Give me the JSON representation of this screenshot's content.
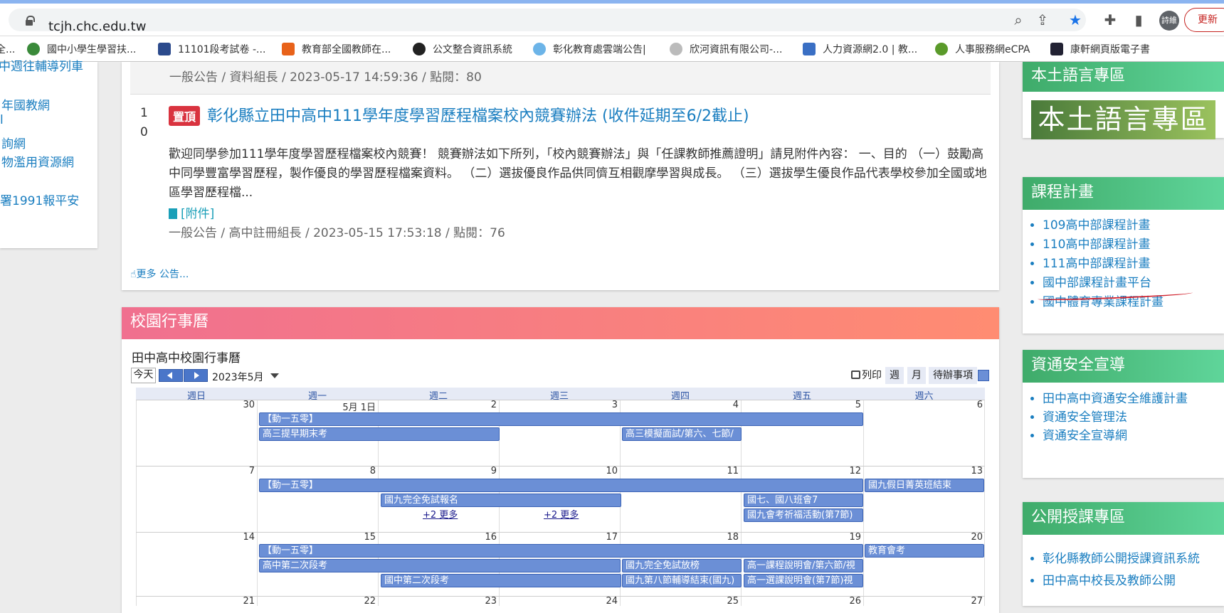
{
  "browser": {
    "url": "tcjh.chc.edu.tw",
    "avatar": "詩維",
    "reload": "更新"
  },
  "bookmarks": [
    {
      "label": "全...",
      "color": "#777"
    },
    {
      "label": "國中小學生學習扶...",
      "color": "#3a8a3a"
    },
    {
      "label": "11101段考試卷 -...",
      "color": "#2b4a8c"
    },
    {
      "label": "教育部全國教師在...",
      "color": "#e8621a"
    },
    {
      "label": "公文整合資訊系統",
      "color": "#222"
    },
    {
      "label": "彰化教育處雲端公告|",
      "color": "#6cb4e8"
    },
    {
      "label": "欣河資訊有限公司-...",
      "color": "#888"
    },
    {
      "label": "人力資源網2.0 | 教...",
      "color": "#3a6fc4"
    },
    {
      "label": "人事服務網eCPA",
      "color": "#5a9a2a"
    },
    {
      "label": "康軒網頁版電子書",
      "color": "#223"
    }
  ],
  "left_links": [
    "中週往輔導列車",
    "年國教網",
    "l",
    "詢網",
    "物濫用資源網",
    "署1991報平安"
  ],
  "news": {
    "meta1": "一般公告 / 資料組長 / 2023-05-17 14:59:36 / 點閱：80",
    "num_a": "1",
    "num_b": "0",
    "badge": "置頂",
    "title": "彰化縣立田中高中111學年度學習歷程檔案校內競賽辦法 (收件延期至6/2截止)",
    "body": "歡迎同學參加111學年度學習歷程檔案校內競賽！ 競賽辦法如下所列，「校內競賽辦法」與「任課教師推薦證明」請見附件內容： 一、目的 （一）鼓勵高中同學豐富學習歷程，製作優良的學習歷程檔案資料。 （二）選拔優良作品供同儕互相觀摩學習與成長。 （三）選拔學生優良作品代表學校參加全國或地區學習歷程檔...",
    "attach": "[附件]",
    "meta2": "一般公告 / 高中註冊組長 / 2023-05-15 17:53:18 / 點閱：76",
    "more": "更多 公告..."
  },
  "calendar": {
    "header": "校園行事曆",
    "title": "田中高中校園行事曆",
    "today": "今天",
    "month": "2023年5月",
    "print": "列印",
    "week": "週",
    "monthview": "月",
    "agenda": "待辦事項",
    "days": [
      "週日",
      "週一",
      "週二",
      "週三",
      "週四",
      "週五",
      "週六"
    ],
    "weeks": [
      {
        "dates": [
          "30",
          "5月 1日",
          "2",
          "3",
          "4",
          "5",
          "6"
        ]
      },
      {
        "dates": [
          "7",
          "8",
          "9",
          "10",
          "11",
          "12",
          "13"
        ]
      },
      {
        "dates": [
          "14",
          "15",
          "16",
          "17",
          "18",
          "19",
          "20"
        ]
      },
      {
        "dates": [
          "21",
          "22",
          "23",
          "24",
          "25",
          "26",
          "27"
        ]
      }
    ],
    "events": {
      "w1a": "【動一五零】",
      "w1b": "高三提早期末考",
      "w1c": "高三模擬面試/第六、七節/",
      "w2a": "【動一五零】",
      "w2b": "國九假日菁英班結束",
      "w2c": "國九完全免試報名",
      "w2d": "國七、國八班會7",
      "w2e": "國九會考祈福活動(第7節)",
      "w2f": "+2 更多",
      "w2g": "+2 更多",
      "w3a": "【動一五零】",
      "w3b": "教育會考",
      "w3c": "高中第二次段考",
      "w3d": "國九完全免試放榜",
      "w3e": "高一課程說明會/第六節/視",
      "w3f": "國中第二次段考",
      "w3g": "國九第八節輔導結束(國九)",
      "w3h": "高一選課說明會(第7節)視"
    }
  },
  "right": {
    "lang": {
      "header": "本土語言專區",
      "banner": "本土語言專區"
    },
    "course": {
      "header": "課程計畫",
      "items": [
        "109高中部課程計畫",
        "110高中部課程計畫",
        "111高中部課程計畫",
        "國中部課程計畫平台",
        "國中體育專業課程計畫"
      ]
    },
    "security": {
      "header": "資通安全宣導",
      "items": [
        "田中高中資通安全維護計畫",
        "資通安全管理法",
        "資通安全宣導網"
      ]
    },
    "open": {
      "header": "公開授課專區",
      "items": [
        "彰化縣教師公開授課資訊系統",
        "田中高中校長及教師公開"
      ]
    }
  }
}
